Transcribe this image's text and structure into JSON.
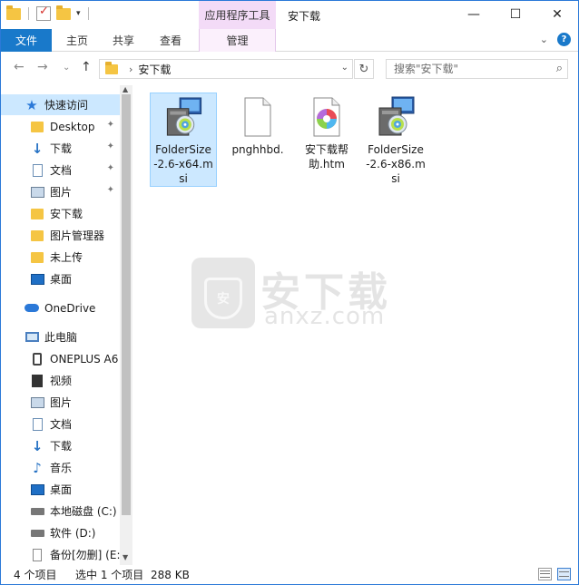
{
  "titlebar": {
    "title": "安下载",
    "context_header": "应用程序工具",
    "minimize": "—",
    "maximize": "☐",
    "close": "✕"
  },
  "ribbon": {
    "tabs": [
      {
        "label": "文件",
        "active": true
      },
      {
        "label": "主页"
      },
      {
        "label": "共享"
      },
      {
        "label": "查看"
      },
      {
        "label": "管理"
      }
    ],
    "expand": "⌄",
    "help": "?"
  },
  "navigation": {
    "back": "←",
    "forward": "→",
    "recent": "⌄",
    "up": "↑",
    "path_separator": "›",
    "path": "安下载",
    "refresh": "↻",
    "search_placeholder": "搜索\"安下载\"",
    "search_icon": "⌕"
  },
  "sidebar": {
    "items": [
      {
        "label": "快速访问",
        "icon": "star-icon",
        "selected": true
      },
      {
        "label": "Desktop",
        "icon": "folder-icon",
        "pinned": true
      },
      {
        "label": "下载",
        "icon": "download-icon",
        "pinned": true
      },
      {
        "label": "文档",
        "icon": "document-icon",
        "pinned": true
      },
      {
        "label": "图片",
        "icon": "picture-icon",
        "pinned": true
      },
      {
        "label": "安下载",
        "icon": "folder-icon"
      },
      {
        "label": "图片管理器",
        "icon": "folder-icon"
      },
      {
        "label": "未上传",
        "icon": "folder-icon"
      },
      {
        "label": "桌面",
        "icon": "desktop-icon"
      },
      {
        "label": "OneDrive",
        "icon": "cloud-icon"
      },
      {
        "label": "此电脑",
        "icon": "computer-icon"
      },
      {
        "label": "ONEPLUS A6",
        "icon": "phone-icon"
      },
      {
        "label": "视频",
        "icon": "video-icon"
      },
      {
        "label": "图片",
        "icon": "picture-icon"
      },
      {
        "label": "文档",
        "icon": "document-icon"
      },
      {
        "label": "下载",
        "icon": "download-icon"
      },
      {
        "label": "音乐",
        "icon": "music-icon"
      },
      {
        "label": "桌面",
        "icon": "desktop-icon"
      },
      {
        "label": "本地磁盘 (C:)",
        "icon": "drive-icon"
      },
      {
        "label": "软件 (D:)",
        "icon": "drive-icon"
      },
      {
        "label": "备份[勿删] (E:",
        "icon": "file-icon"
      }
    ],
    "pin_glyph": "📌"
  },
  "files": [
    {
      "name": "FolderSize-2.6-x64.msi",
      "display": "FolderSize\n-2.6-x64.m\nsi",
      "icon": "installer-icon",
      "selected": true
    },
    {
      "name": "pnghhbd.",
      "display": "pnghhbd.",
      "icon": "blank-file-icon"
    },
    {
      "name": "安下载帮助.htm",
      "display": "安下载帮\n助.htm",
      "icon": "html-file-icon"
    },
    {
      "name": "FolderSize-2.6-x86.msi",
      "display": "FolderSize\n-2.6-x86.m\nsi",
      "icon": "installer-icon"
    }
  ],
  "watermark": {
    "cn": "安下载",
    "en": "anxz.com",
    "shield_char": "安"
  },
  "statusbar": {
    "item_count": "4 个项目",
    "selected": "选中 1 个项目",
    "size": "288 KB"
  },
  "colors": {
    "accent": "#1979ca",
    "selection": "#cce8ff",
    "context_tab": "#f3dbf7"
  }
}
